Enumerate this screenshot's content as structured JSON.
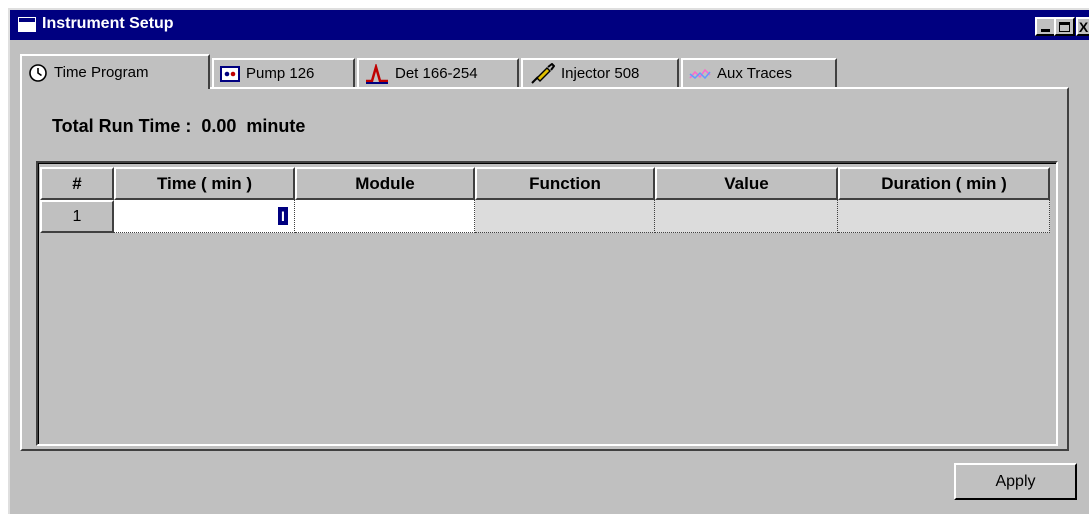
{
  "window": {
    "title": "Instrument Setup"
  },
  "title_buttons": [
    {
      "icon": "minimize-icon"
    },
    {
      "icon": "maximize-icon"
    },
    {
      "label": "X",
      "icon": "close-icon"
    }
  ],
  "tabs": [
    {
      "label": "Time Program",
      "icon": "clock-icon",
      "active": true
    },
    {
      "label": "Pump 126",
      "icon": "pump-icon"
    },
    {
      "label": "Det 166-254",
      "icon": "detector-peak-icon"
    },
    {
      "label": "Injector 508",
      "icon": "syringe-icon"
    },
    {
      "label": "Aux Traces",
      "icon": "traces-icon"
    }
  ],
  "run_time": {
    "text": "Total Run Time :  0.00  minute"
  },
  "table": {
    "columns": [
      "#",
      "Time ( min )",
      "Module",
      "Function",
      "Value",
      "Duration ( min )"
    ],
    "rows": [
      {
        "index": "1",
        "time": "",
        "module": "",
        "function": "",
        "value": "",
        "duration": ""
      }
    ]
  },
  "apply_button": {
    "label": "Apply"
  },
  "colors": {
    "titlebar": "#000080",
    "window": "#c0c0c0",
    "editable_cell": "#ffffff",
    "readonly_cell": "#dcdcdc"
  }
}
